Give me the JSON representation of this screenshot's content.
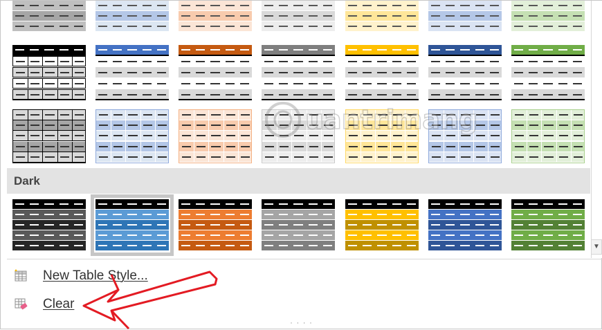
{
  "gallery": {
    "section_dark_label": "Dark",
    "colors": {
      "black": {
        "dark": "#000000",
        "light": "#d9d9d9",
        "mid": "#a6a6a6",
        "deep": "#404040",
        "grid": "#7f7f7f"
      },
      "blue": {
        "dark": "#4472c4",
        "light": "#dce6f2",
        "mid": "#b4c7e7",
        "deep": "#2f5597",
        "grid": "#8faadc",
        "darktheme": "#5b9bd5",
        "darktheme2": "#2e75b6"
      },
      "orange": {
        "dark": "#c55a11",
        "light": "#fbe5d6",
        "mid": "#f8cbad",
        "deep": "#c55a11",
        "grid": "#f4b183",
        "darktheme": "#ed7d31",
        "darktheme2": "#c55a11"
      },
      "gray": {
        "dark": "#7f7f7f",
        "light": "#ededed",
        "mid": "#d9d9d9",
        "deep": "#7f7f7f",
        "grid": "#c9c9c9",
        "darktheme": "#a5a5a5",
        "darktheme2": "#7f7f7f"
      },
      "gold": {
        "dark": "#ffc000",
        "light": "#fff2cc",
        "mid": "#ffe699",
        "deep": "#bf9000",
        "grid": "#ffd966",
        "darktheme": "#ffc000",
        "darktheme2": "#bf9000"
      },
      "navy": {
        "dark": "#2f5597",
        "light": "#dae3f3",
        "mid": "#b4c7e7",
        "deep": "#203864",
        "grid": "#8faadc",
        "darktheme": "#4472c4",
        "darktheme2": "#2f5597"
      },
      "green": {
        "dark": "#70ad47",
        "light": "#e2efd9",
        "mid": "#c5e0b3",
        "deep": "#538135",
        "grid": "#a9d18e",
        "darktheme": "#70ad47",
        "darktheme2": "#538135"
      }
    }
  },
  "menu": {
    "new_table_style_label": "New Table Style...",
    "clear_label": "Clear"
  },
  "watermark": {
    "text": "uantrimang"
  },
  "annotation": {
    "color": "#e31b23"
  }
}
